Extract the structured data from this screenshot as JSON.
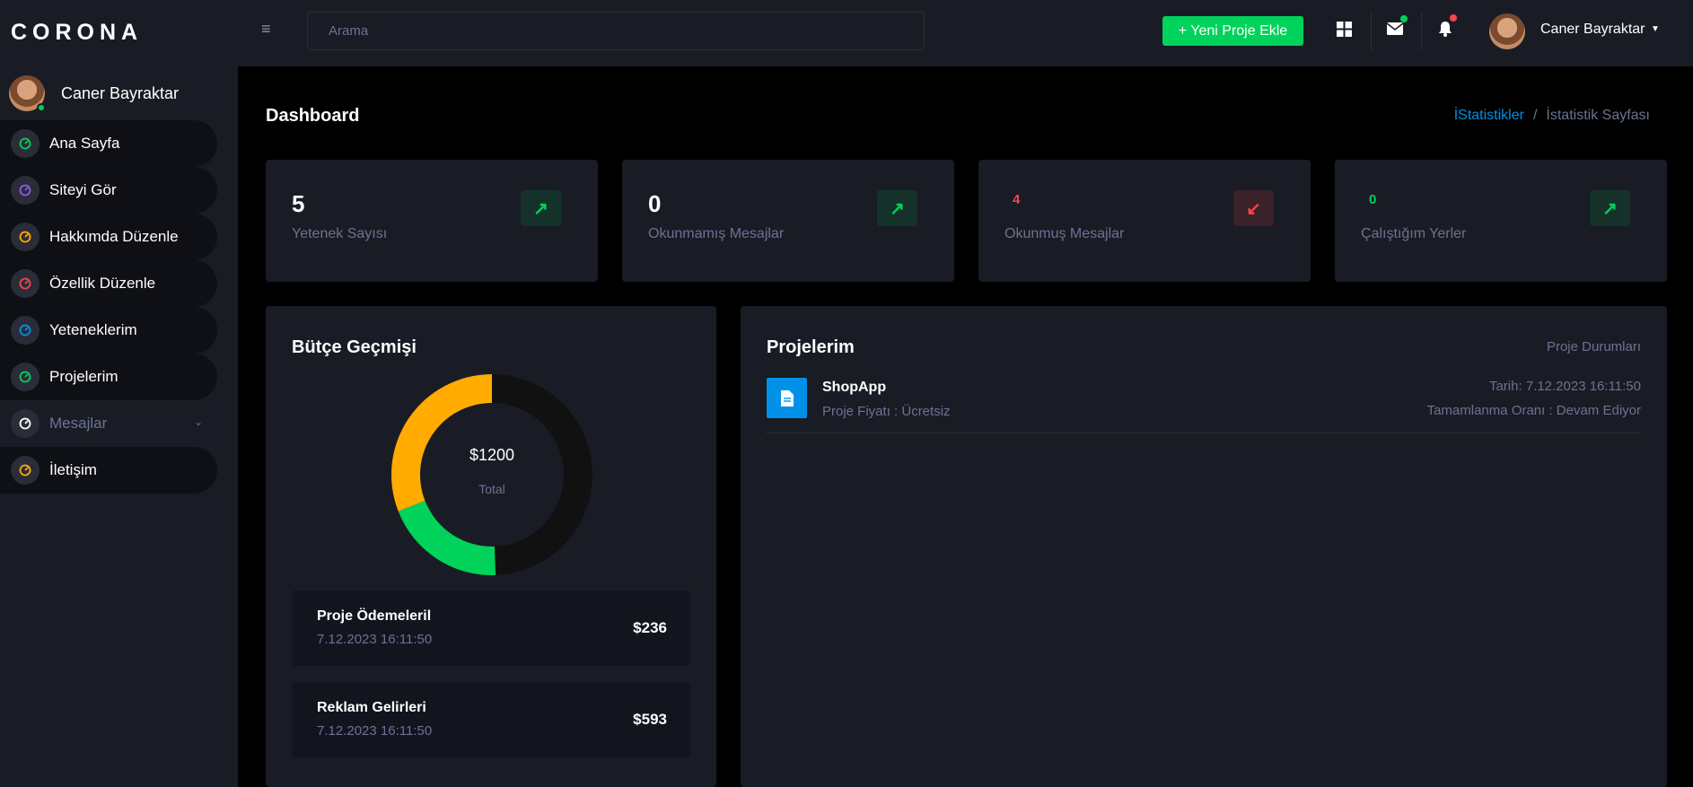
{
  "app": {
    "brand": "CORONA"
  },
  "profile": {
    "name": "Caner Bayraktar"
  },
  "sidebar": {
    "items": [
      {
        "label": "Ana Sayfa",
        "icon": "speedometer-icon",
        "color": "#00d25b"
      },
      {
        "label": "Siteyi Gör",
        "icon": "speedometer-icon",
        "color": "#8f5fe8"
      },
      {
        "label": "Hakkımda Düzenle",
        "icon": "speedometer-icon",
        "color": "#ffab00"
      },
      {
        "label": "Özellik Düzenle",
        "icon": "speedometer-icon",
        "color": "#fc424a"
      },
      {
        "label": "Yeteneklerim",
        "icon": "speedometer-icon",
        "color": "#0090e7"
      },
      {
        "label": "Projelerim",
        "icon": "speedometer-icon",
        "color": "#00d25b"
      },
      {
        "label": "Mesajlar",
        "icon": "speedometer-icon",
        "color": "#ffffff"
      },
      {
        "label": "İletişim",
        "icon": "speedometer-icon",
        "color": "#ffab00"
      }
    ]
  },
  "topbar": {
    "search_placeholder": "Arama",
    "new_project_label": "+ Yeni Proje Ekle",
    "user_name": "Caner Bayraktar"
  },
  "page": {
    "title": "Dashboard",
    "breadcrumb": {
      "link": "İStatistikler",
      "separator": "/",
      "current": "İstatistik Sayfası"
    }
  },
  "stats": [
    {
      "value": "5",
      "label": "Yetenek Sayısı",
      "trend": "up"
    },
    {
      "value": "0",
      "label": "Okunmamış Mesajlar",
      "trend": "up"
    },
    {
      "value": "4",
      "label": "Okunmuş Mesajlar",
      "trend": "down",
      "value_color": "#fc424a"
    },
    {
      "value": "0",
      "label": "Çalıştığım Yerler",
      "trend": "up",
      "value_color": "#00d25b"
    }
  ],
  "budget": {
    "title": "Bütçe Geçmişi",
    "total_value": "$1200",
    "total_label": "Total",
    "items": [
      {
        "title": "Proje Ödemeleril",
        "date": "7.12.2023 16:11:50",
        "amount": "$236"
      },
      {
        "title": "Reklam Gelirleri",
        "date": "7.12.2023 16:11:50",
        "amount": "$593"
      }
    ]
  },
  "chart_data": {
    "type": "pie",
    "title": "Bütçe Geçmişi",
    "categories": [
      "",
      "",
      ""
    ],
    "values": [
      593,
      236,
      371
    ],
    "colors": [
      "#111111",
      "#00d25b",
      "#ffab00"
    ]
  },
  "projects": {
    "title": "Projelerim",
    "header_right": "Proje Durumları",
    "items": [
      {
        "name": "ShopApp",
        "price": "Proje Fiyatı : Ücretsiz",
        "date": "Tarih: 7.12.2023 16:11:50",
        "status": "Tamamlanma Oranı : Devam Ediyor"
      }
    ]
  }
}
